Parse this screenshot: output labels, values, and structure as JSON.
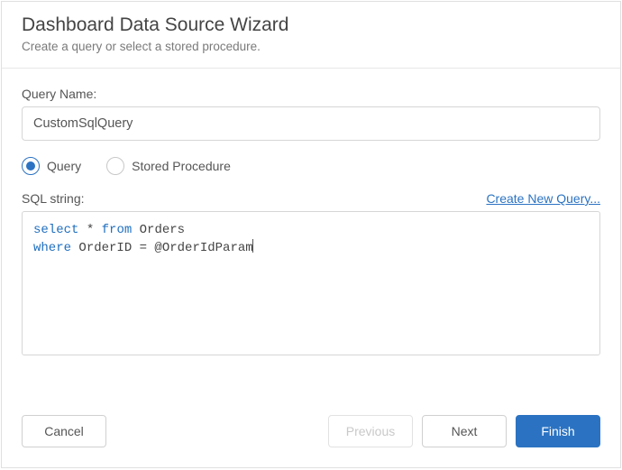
{
  "header": {
    "title": "Dashboard Data Source Wizard",
    "subtitle": "Create a query or select a stored procedure."
  },
  "queryName": {
    "label": "Query Name:",
    "value": "CustomSqlQuery"
  },
  "queryType": {
    "options": {
      "query": "Query",
      "storedProcedure": "Stored Procedure"
    },
    "selected": "query"
  },
  "sql": {
    "label": "SQL string:",
    "createLink": "Create New Query...",
    "tokens": {
      "line1_select": "select",
      "line1_star": " * ",
      "line1_from": "from",
      "line1_table": " Orders",
      "line2_where": "where",
      "line2_rest": " OrderID = @OrderIdParam"
    }
  },
  "footer": {
    "cancel": "Cancel",
    "previous": "Previous",
    "next": "Next",
    "finish": "Finish"
  },
  "colors": {
    "accent": "#2b73c2"
  }
}
